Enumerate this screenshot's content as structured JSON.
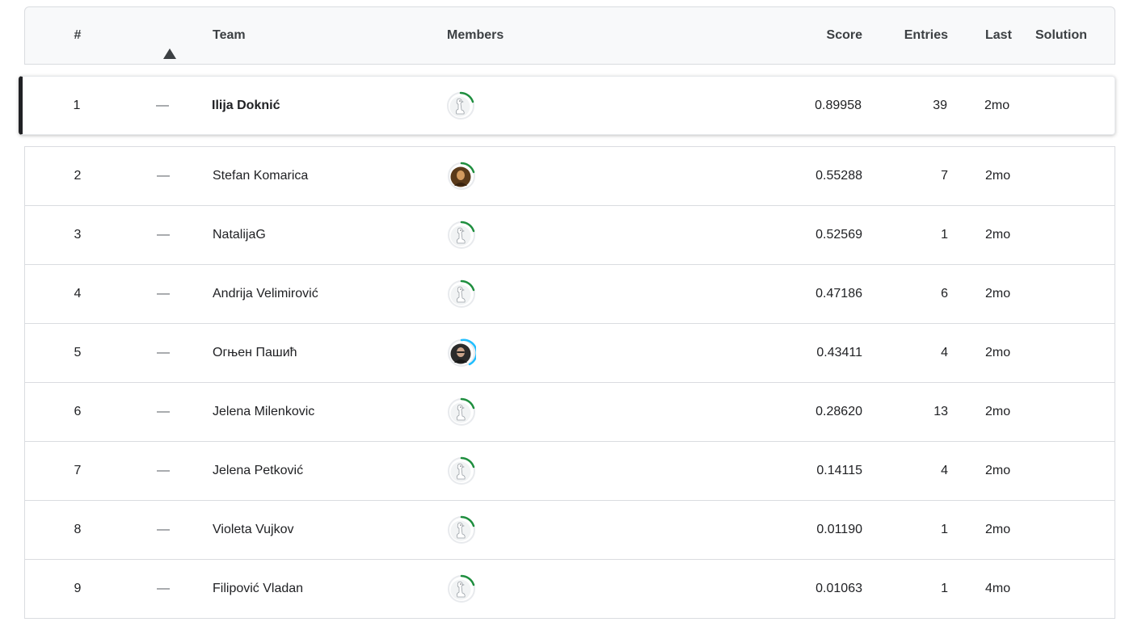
{
  "header": {
    "rank": "#",
    "delta_icon": "delta-triangle-icon",
    "team": "Team",
    "members": "Members",
    "score": "Score",
    "entries": "Entries",
    "last": "Last",
    "solution": "Solution"
  },
  "rows": [
    {
      "rank": "1",
      "delta": "—",
      "team": "Ilija Doknić",
      "avatar": "goose-avatar-icon",
      "ring_color": "#1e8e3e",
      "score": "0.89958",
      "entries": "39",
      "last": "2mo"
    },
    {
      "rank": "2",
      "delta": "—",
      "team": "Stefan Komarica",
      "avatar": "photo-avatar-icon",
      "ring_color": "#1e8e3e",
      "score": "0.55288",
      "entries": "7",
      "last": "2mo"
    },
    {
      "rank": "3",
      "delta": "—",
      "team": "NatalijaG",
      "avatar": "goose-avatar-icon",
      "ring_color": "#1e8e3e",
      "score": "0.52569",
      "entries": "1",
      "last": "2mo"
    },
    {
      "rank": "4",
      "delta": "—",
      "team": "Andrija Velimirović",
      "avatar": "goose-avatar-icon",
      "ring_color": "#1e8e3e",
      "score": "0.47186",
      "entries": "6",
      "last": "2mo"
    },
    {
      "rank": "5",
      "delta": "—",
      "team": "Огњен Пашић",
      "avatar": "photo-avatar-icon",
      "ring_color": "#20beff",
      "score": "0.43411",
      "entries": "4",
      "last": "2mo"
    },
    {
      "rank": "6",
      "delta": "—",
      "team": "Jelena Milenkovic",
      "avatar": "goose-avatar-icon",
      "ring_color": "#1e8e3e",
      "score": "0.28620",
      "entries": "13",
      "last": "2mo"
    },
    {
      "rank": "7",
      "delta": "—",
      "team": "Jelena Petković",
      "avatar": "goose-avatar-icon",
      "ring_color": "#1e8e3e",
      "score": "0.14115",
      "entries": "4",
      "last": "2mo"
    },
    {
      "rank": "8",
      "delta": "—",
      "team": "Violeta Vujkov",
      "avatar": "goose-avatar-icon",
      "ring_color": "#1e8e3e",
      "score": "0.01190",
      "entries": "1",
      "last": "2mo"
    },
    {
      "rank": "9",
      "delta": "—",
      "team": "Filipović Vladan",
      "avatar": "goose-avatar-icon",
      "ring_color": "#1e8e3e",
      "score": "0.01063",
      "entries": "1",
      "last": "4mo"
    }
  ]
}
